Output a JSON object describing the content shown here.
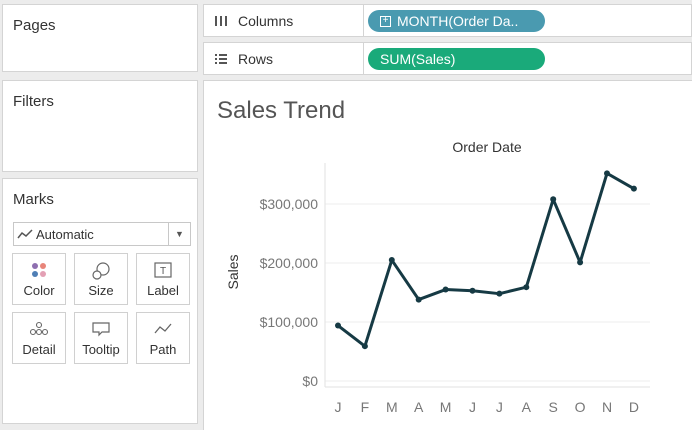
{
  "pages_panel": {
    "title": "Pages"
  },
  "filters_panel": {
    "title": "Filters"
  },
  "marks_panel": {
    "title": "Marks",
    "mark_type": "Automatic",
    "buttons": [
      {
        "label": "Color",
        "icon": "color-icon"
      },
      {
        "label": "Size",
        "icon": "size-icon"
      },
      {
        "label": "Label",
        "icon": "label-icon"
      },
      {
        "label": "Detail",
        "icon": "detail-icon"
      },
      {
        "label": "Tooltip",
        "icon": "tooltip-icon"
      },
      {
        "label": "Path",
        "icon": "path-icon"
      }
    ]
  },
  "shelves": {
    "columns": {
      "label": "Columns",
      "pill": "MONTH(Order Da.."
    },
    "rows": {
      "label": "Rows",
      "pill": "SUM(Sales)"
    }
  },
  "colors": {
    "columns_pill": "#4a9ab0",
    "rows_pill": "#1aaa7a",
    "line": "#163a44"
  },
  "viz": {
    "title": "Sales Trend"
  },
  "chart_data": {
    "type": "line",
    "title": "Order Date",
    "xlabel": "",
    "ylabel": "Sales",
    "categories": [
      "J",
      "F",
      "M",
      "A",
      "M",
      "J",
      "J",
      "A",
      "S",
      "O",
      "N",
      "D"
    ],
    "values": [
      94000,
      59000,
      205000,
      138000,
      155000,
      153000,
      148000,
      159000,
      308000,
      201000,
      352000,
      326000
    ],
    "y_ticks": [
      0,
      100000,
      200000,
      300000
    ],
    "y_tick_labels": [
      "$0",
      "$100,000",
      "$200,000",
      "$300,000"
    ],
    "ylim": [
      0,
      380000
    ],
    "grid": true
  }
}
